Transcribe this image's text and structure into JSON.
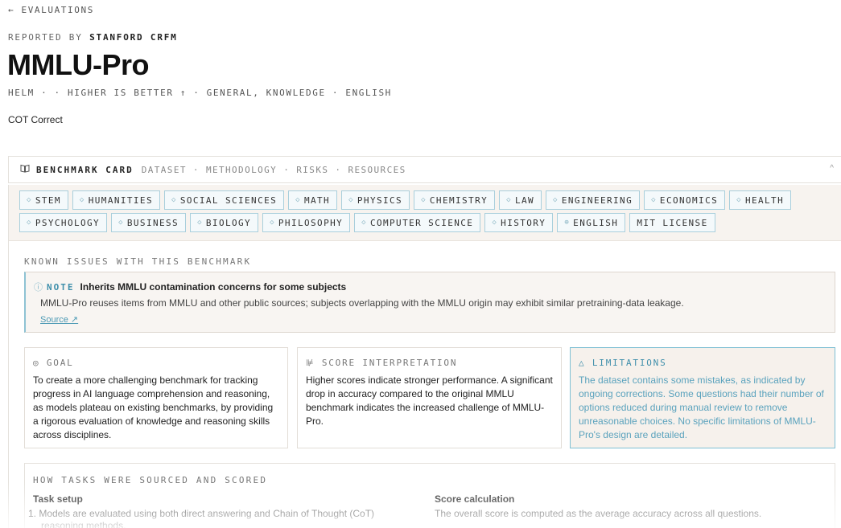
{
  "nav": {
    "back_label": "EVALUATIONS"
  },
  "header": {
    "reported_prefix": "REPORTED BY",
    "reporter": "STANFORD CRFM",
    "title": "MMLU-Pro",
    "meta": "HELM ·  · HIGHER IS BETTER ↑ · GENERAL, KNOWLEDGE · ENGLISH",
    "metric": "COT Correct"
  },
  "benchmark_card": {
    "label": "BENCHMARK CARD",
    "sections": "DATASET · METHODOLOGY · RISKS · RESOURCES",
    "icon": "book-icon",
    "collapse_icon": "chevron-up-icon"
  },
  "tags": {
    "row1": [
      "STEM",
      "HUMANITIES",
      "SOCIAL SCIENCES",
      "MATH",
      "PHYSICS",
      "CHEMISTRY",
      "LAW",
      "ENGINEERING",
      "ECONOMICS",
      "HEALTH"
    ],
    "row2": [
      "PSYCHOLOGY",
      "BUSINESS",
      "BIOLOGY",
      "PHILOSOPHY",
      "COMPUTER SCIENCE",
      "HISTORY"
    ],
    "language": "ENGLISH",
    "license": "MIT LICENSE"
  },
  "known_issues": {
    "label": "KNOWN ISSUES WITH THIS BENCHMARK",
    "note_tag": "NOTE",
    "note_heading": "Inherits MMLU contamination concerns for some subjects",
    "note_text": "MMLU-Pro reuses items from MMLU and other public sources; subjects overlapping with the MMLU origin may exhibit similar pretraining-data leakage.",
    "source_label": "Source ↗"
  },
  "goal": {
    "label": "GOAL",
    "text": "To create a more challenging benchmark for tracking progress in AI language comprehension and reasoning, as models plateau on existing benchmarks, by providing a rigorous evaluation of knowledge and reasoning skills across disciplines."
  },
  "score_interpretation": {
    "label": "SCORE INTERPRETATION",
    "text": "Higher scores indicate stronger performance. A significant drop in accuracy compared to the original MMLU benchmark indicates the increased challenge of MMLU-Pro."
  },
  "limitations": {
    "label": "LIMITATIONS",
    "text": "The dataset contains some mistakes, as indicated by ongoing corrections. Some questions had their number of options reduced during manual review to remove unreasonable choices. No specific limitations of MMLU-Pro's design are detailed."
  },
  "how_sourced": {
    "label": "HOW TASKS WERE SOURCED AND SCORED",
    "task_setup_heading": "Task setup",
    "task_setup_item1": "1. Models are evaluated using both direct answering and Chain of Thought (CoT)",
    "task_setup_item1_cont": "reasoning methods.",
    "score_calc_heading": "Score calculation",
    "score_calc_text": "The overall score is computed as the average accuracy across all questions."
  },
  "colors": {
    "accent": "#3f8fab",
    "tag_border": "#a9cfdc",
    "band_bg": "#f7f3ef"
  }
}
